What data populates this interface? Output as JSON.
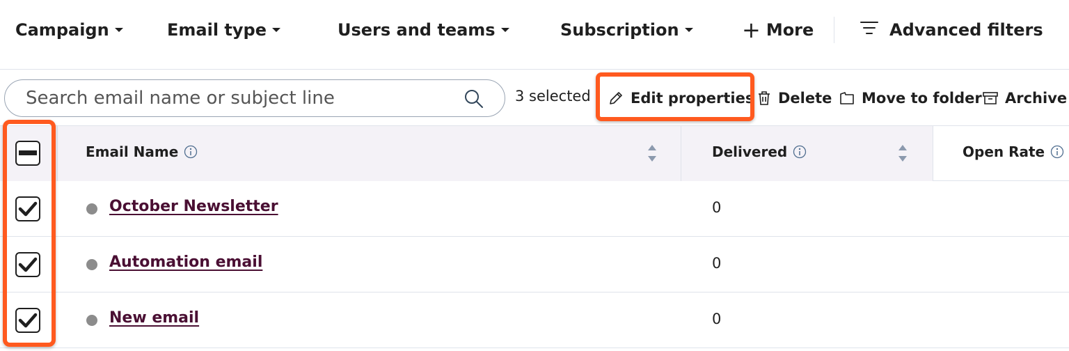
{
  "filters": {
    "campaign": "Campaign",
    "email_type": "Email type",
    "users_teams": "Users and teams",
    "subscription": "Subscription",
    "more": "More",
    "advanced": "Advanced filters"
  },
  "search": {
    "placeholder": "Search email name or subject line",
    "value": ""
  },
  "toolbar": {
    "selected_count": "3 selected",
    "edit_properties": "Edit properties",
    "delete": "Delete",
    "move_to_folder": "Move to folder",
    "archive": "Archive"
  },
  "table": {
    "columns": [
      "Email Name",
      "Delivered",
      "Open Rate"
    ],
    "header_checkbox_state": "indeterminate",
    "rows": [
      {
        "name": "October Newsletter",
        "delivered": "0",
        "checked": true
      },
      {
        "name": "Automation email",
        "delivered": "0",
        "checked": true
      },
      {
        "name": "New email",
        "delivered": "0",
        "checked": true
      }
    ]
  },
  "colors": {
    "highlight": "#ff5a1f",
    "link": "#4a0f33",
    "header_bg": "#f4f2f7",
    "status_dot": "#8c8c8c"
  },
  "icons": [
    "caret-down-icon",
    "plus-icon",
    "filter-lines-icon",
    "search-icon",
    "pencil-icon",
    "trash-icon",
    "folder-icon",
    "archive-icon",
    "info-icon",
    "sort-icon",
    "check-icon",
    "minus-icon"
  ]
}
